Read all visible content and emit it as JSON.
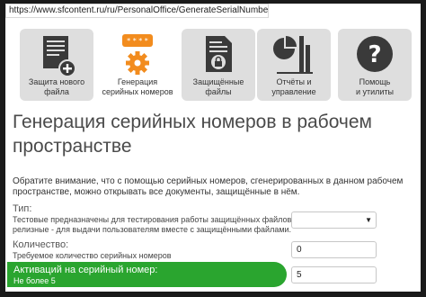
{
  "browser": {
    "url": "https://www.sfcontent.ru/ru/PersonalOffice/GenerateSerialNumbers"
  },
  "nav": {
    "tiles": [
      {
        "label1": "Защита нового",
        "label2": "файла",
        "icon": "document-add-icon"
      },
      {
        "label1": "Генерация",
        "label2": "серийных номеров",
        "icon": "gear-serial-icon",
        "active": true,
        "badge": "* * * *"
      },
      {
        "label1": "Защищённые",
        "label2": "файлы",
        "icon": "document-lock-icon"
      },
      {
        "label1": "Отчёты и",
        "label2": "управление",
        "icon": "chart-icon"
      },
      {
        "label1": "Помощь",
        "label2": "и утилиты",
        "icon": "question-icon"
      }
    ]
  },
  "page": {
    "title": "Генерация серийных номеров в рабочем пространстве",
    "notice_line1": "Обратите внимание, что с помощью серийных номеров, сгенерированных в данном рабочем",
    "notice_line2": "пространстве, можно открывать все документы, защищённые в нём."
  },
  "form": {
    "type": {
      "label": "Тип:",
      "hint1": "Тестовые предназначены для тестирования работы защищённых файлов,",
      "hint2": "релизные - для выдачи пользователям вместе с защищёнными файлами.",
      "value": ""
    },
    "quantity": {
      "label": "Количество:",
      "hint": "Требуемое количество серийных номеров",
      "value": "0"
    },
    "activations": {
      "label": "Активаций на серийный номер:",
      "hint": "Не более 5",
      "value": "5"
    }
  },
  "colors": {
    "accent_orange": "#f28c1e",
    "active_green": "#2aa52f",
    "icon_dark": "#3a3a3a"
  }
}
